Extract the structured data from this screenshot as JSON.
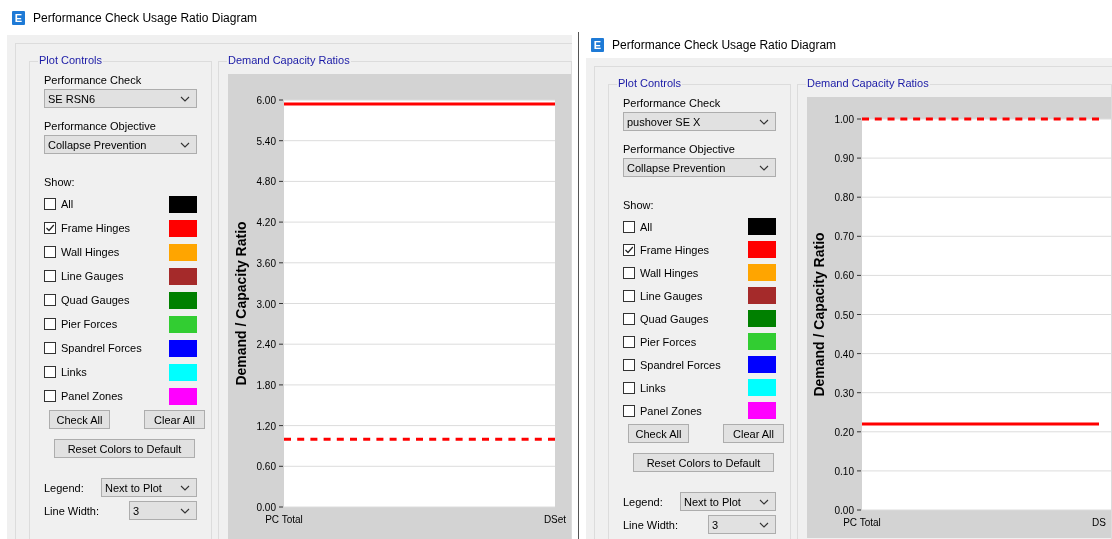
{
  "windows": [
    {
      "icon_letter": "E",
      "title": "Performance Check Usage Ratio Diagram",
      "plot_controls": {
        "title": "Plot Controls",
        "performance_check": {
          "label": "Performance Check",
          "value": "SE RSN6"
        },
        "performance_objective": {
          "label": "Performance Objective",
          "value": "Collapse Prevention"
        },
        "show_label": "Show:",
        "items": [
          {
            "label": "All",
            "checked": false,
            "color": "#000000"
          },
          {
            "label": "Frame Hinges",
            "checked": true,
            "color": "#ff0000"
          },
          {
            "label": "Wall Hinges",
            "checked": false,
            "color": "#ffa500"
          },
          {
            "label": "Line Gauges",
            "checked": false,
            "color": "#a52a2a"
          },
          {
            "label": "Quad Gauges",
            "checked": false,
            "color": "#008000"
          },
          {
            "label": "Pier Forces",
            "checked": false,
            "color": "#32cd32"
          },
          {
            "label": "Spandrel Forces",
            "checked": false,
            "color": "#0000ff"
          },
          {
            "label": "Links",
            "checked": false,
            "color": "#00ffff"
          },
          {
            "label": "Panel Zones",
            "checked": false,
            "color": "#ff00ff"
          }
        ],
        "buttons": [
          "Check All",
          "Clear All",
          "Reset Colors to Default"
        ],
        "legend": {
          "label": "Legend:",
          "value": "Next to Plot"
        },
        "line_width": {
          "label": "Line Width:",
          "value": "3"
        }
      },
      "chart_panel": {
        "title": "Demand Capacity Ratios",
        "chart_data": {
          "type": "line",
          "ylabel": "Demand / Capacity Ratio",
          "categories": [
            "PC Total",
            "DSet"
          ],
          "ylim": [
            0,
            6
          ],
          "yticks": [
            {
              "value": 0,
              "label": "0.00"
            },
            {
              "value": 0.6,
              "label": "0.60"
            },
            {
              "value": 1.2,
              "label": "1.20"
            },
            {
              "value": 1.8,
              "label": "1.80"
            },
            {
              "value": 2.4,
              "label": "2.40"
            },
            {
              "value": 3,
              "label": "3.00"
            },
            {
              "value": 3.6,
              "label": "3.60"
            },
            {
              "value": 4.2,
              "label": "4.20"
            },
            {
              "value": 4.8,
              "label": "4.80"
            },
            {
              "value": 5.4,
              "label": "5.40"
            },
            {
              "value": 6,
              "label": "6.00"
            }
          ],
          "series": [
            {
              "color": "#ff0000",
              "line_style": "solid",
              "values": [
                5.94,
                5.94
              ]
            },
            {
              "color": "#ff0000",
              "line_style": "dashed",
              "values": [
                1,
                1
              ]
            }
          ]
        }
      }
    },
    {
      "icon_letter": "E",
      "title": "Performance Check Usage Ratio Diagram",
      "plot_controls": {
        "title": "Plot Controls",
        "performance_check": {
          "label": "Performance Check",
          "value": "pushover SE X"
        },
        "performance_objective": {
          "label": "Performance Objective",
          "value": "Collapse Prevention"
        },
        "show_label": "Show:",
        "items": [
          {
            "label": "All",
            "checked": false,
            "color": "#000000"
          },
          {
            "label": "Frame Hinges",
            "checked": true,
            "color": "#ff0000"
          },
          {
            "label": "Wall Hinges",
            "checked": false,
            "color": "#ffa500"
          },
          {
            "label": "Line Gauges",
            "checked": false,
            "color": "#a52a2a"
          },
          {
            "label": "Quad Gauges",
            "checked": false,
            "color": "#008000"
          },
          {
            "label": "Pier Forces",
            "checked": false,
            "color": "#32cd32"
          },
          {
            "label": "Spandrel Forces",
            "checked": false,
            "color": "#0000ff"
          },
          {
            "label": "Links",
            "checked": false,
            "color": "#00ffff"
          },
          {
            "label": "Panel Zones",
            "checked": false,
            "color": "#ff00ff"
          }
        ],
        "buttons": [
          "Check All",
          "Clear All",
          "Reset Colors to Default"
        ],
        "legend": {
          "label": "Legend:",
          "value": "Next to Plot"
        },
        "line_width": {
          "label": "Line Width:",
          "value": "3"
        }
      },
      "chart_panel": {
        "title": "Demand Capacity Ratios",
        "chart_data": {
          "type": "line",
          "ylabel": "Demand / Capacity Ratio",
          "categories": [
            "PC Total",
            "DS"
          ],
          "ylim": [
            0,
            1
          ],
          "yticks": [
            {
              "value": 0,
              "label": "0.00"
            },
            {
              "value": 0.1,
              "label": "0.10"
            },
            {
              "value": 0.2,
              "label": "0.20"
            },
            {
              "value": 0.3,
              "label": "0.30"
            },
            {
              "value": 0.4,
              "label": "0.40"
            },
            {
              "value": 0.5,
              "label": "0.50"
            },
            {
              "value": 0.6,
              "label": "0.60"
            },
            {
              "value": 0.7,
              "label": "0.70"
            },
            {
              "value": 0.8,
              "label": "0.80"
            },
            {
              "value": 0.9,
              "label": "0.90"
            },
            {
              "value": 1,
              "label": "1.00"
            }
          ],
          "series": [
            {
              "color": "#ff0000",
              "line_style": "solid",
              "values": [
                0.22,
                0.22
              ]
            },
            {
              "color": "#ff0000",
              "line_style": "dashed",
              "values": [
                1,
                1
              ]
            }
          ]
        }
      }
    }
  ]
}
